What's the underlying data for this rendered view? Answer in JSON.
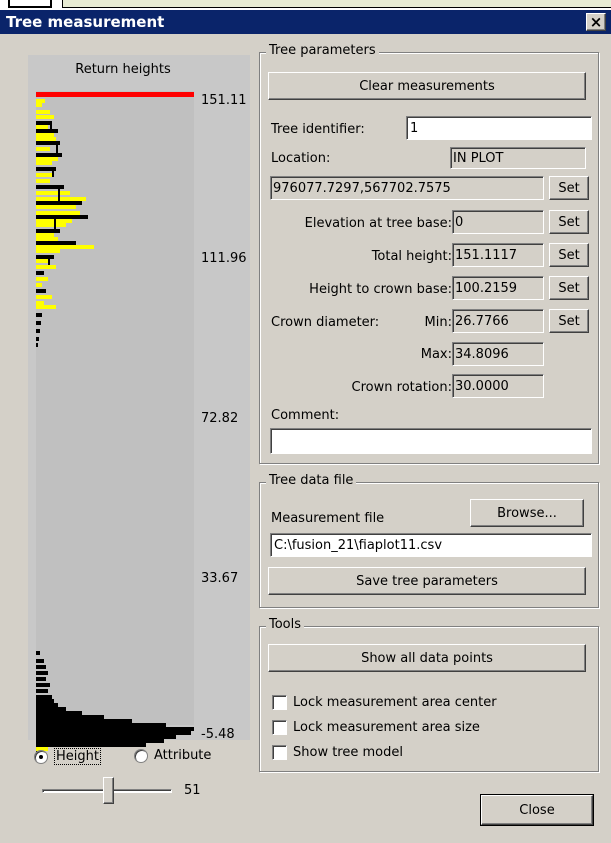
{
  "window": {
    "title": "Tree measurement",
    "close_glyph": "×",
    "accent_color": "#0a246a",
    "background_color": "#d4d0c8"
  },
  "histogram": {
    "title": "Return heights",
    "axis_labels": [
      "151.11",
      "111.96",
      "72.82",
      "33.67",
      "-5.48"
    ],
    "marker_color": "#ff0000",
    "plot_color": "#c0c0c0",
    "in_crown_color": "#ffff00",
    "return_color": "#000000"
  },
  "view_mode": {
    "options": [
      {
        "label": "Height",
        "selected": true
      },
      {
        "label": "Attribute",
        "selected": false
      }
    ]
  },
  "slider": {
    "value": "51",
    "level": 0.51
  },
  "tree_parameters": {
    "legend": "Tree parameters",
    "clear_label": "Clear measurements",
    "identifier_label": "Tree identifier:",
    "identifier_value": "1",
    "location_label": "Location:",
    "location_status": "IN PLOT",
    "location_value": "976077.7297,567702.7575",
    "set_label": "Set",
    "elevation_label": "Elevation at tree base:",
    "elevation_value": "0",
    "total_height_label": "Total height:",
    "total_height_value": "151.1117",
    "crown_base_label": "Height to crown base:",
    "crown_base_value": "100.2159",
    "crown_diameter_label": "Crown diameter:",
    "min_label": "Min:",
    "min_value": "26.7766",
    "max_label": "Max:",
    "max_value": "34.8096",
    "crown_rotation_label": "Crown rotation:",
    "crown_rotation_value": "30.0000",
    "comment_label": "Comment:",
    "comment_value": ""
  },
  "tree_data_file": {
    "legend": "Tree data file",
    "measurement_label": "Measurement file",
    "browse_label": "Browse...",
    "file_value": "C:\\fusion_21\\fiaplot11.csv",
    "save_label": "Save tree parameters"
  },
  "tools": {
    "legend": "Tools",
    "show_all_label": "Show all data points",
    "checkboxes": [
      {
        "label": "Lock measurement area center",
        "checked": false
      },
      {
        "label": "Lock measurement area size",
        "checked": false
      },
      {
        "label": "Show tree model",
        "checked": false
      }
    ]
  },
  "close_label": "Close"
}
